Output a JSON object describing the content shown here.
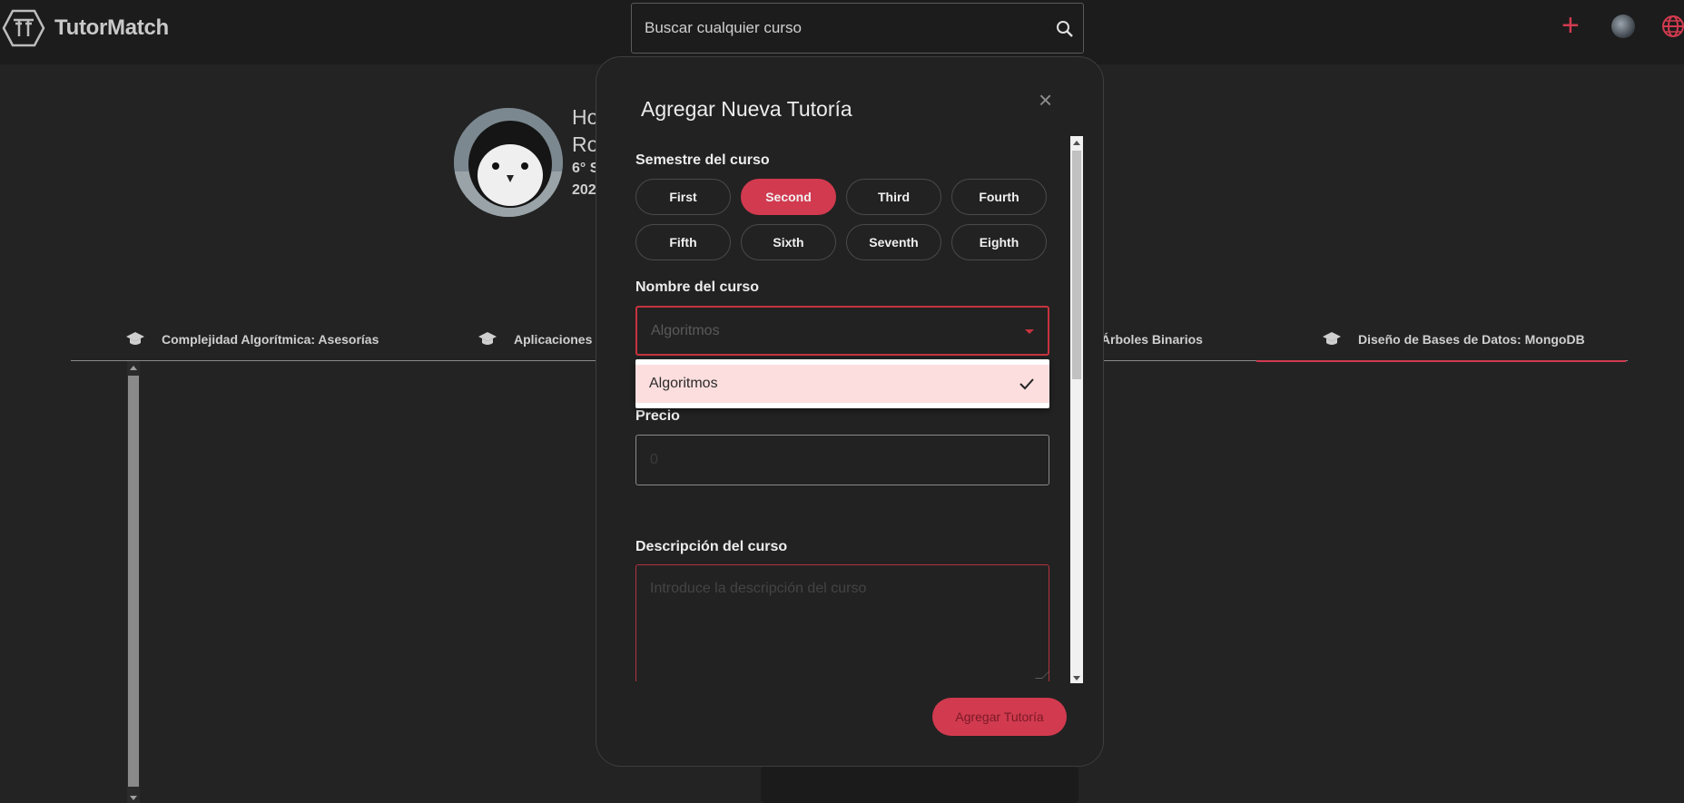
{
  "app": {
    "name": "TutorMatch"
  },
  "search": {
    "placeholder": "Buscar cualquier curso"
  },
  "profile": {
    "line1": "Ho",
    "line2": "Ro",
    "line3": "6° S",
    "line4": "202"
  },
  "tabs": [
    {
      "label": "Complejidad Algorítmica: Asesorías"
    },
    {
      "label": "Aplicaciones W"
    },
    {
      "label": "os: Árboles Binarios"
    },
    {
      "label": "Diseño de Bases de Datos: MongoDB"
    }
  ],
  "modal": {
    "title": "Agregar Nueva Tutoría",
    "close": "×",
    "semester_label": "Semestre del curso",
    "semesters": [
      "First",
      "Second",
      "Third",
      "Fourth",
      "Fifth",
      "Sixth",
      "Seventh",
      "Eighth"
    ],
    "selected_semester": "Second",
    "course_name_label": "Nombre del curso",
    "course_name_value": "Algoritmos",
    "dropdown_option": "Algoritmos",
    "price_label": "Precio",
    "price_value": "0",
    "description_label": "Descripción del curso",
    "description_placeholder": "Introduce la descripción del curso",
    "submit_label": "Agregar Tutoría"
  },
  "colors": {
    "accent": "#d23a4f",
    "background": "#232323",
    "topbar": "#1c1c1c"
  }
}
